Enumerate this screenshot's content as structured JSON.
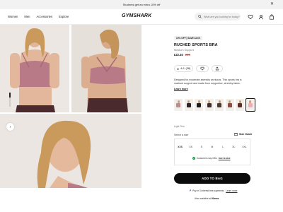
{
  "announcement": {
    "text": "Students get an extra 10% off"
  },
  "nav": {
    "items": [
      "Women",
      "Men",
      "Accessories",
      "Explore"
    ]
  },
  "brand": {
    "logo_text": "GYMSHARK"
  },
  "search": {
    "placeholder": "What are you looking for today?"
  },
  "header_icons": [
    "heart-icon",
    "user-icon",
    "bag-icon"
  ],
  "product": {
    "badge": "10% OFF | SAVE £2.60",
    "title": "RUCHED SPORTS BRA",
    "subtitle": "Medium Support",
    "sale_price": "£22.40",
    "original_price": "£26",
    "rating": "4.6",
    "review_count": "(38)",
    "description": "Designed for moderate-intensity workouts. This sports bra is marbust support and made from supportive, stretchy fabric.",
    "learn_more": "Learn more",
    "color_name": "Light Pink",
    "swatch_colors": [
      "#b98d8f",
      "#2b2424",
      "#1d1d1d",
      "#3a2f2c",
      "#4a3a33",
      "#8e4b40",
      "#5a2f2a",
      "#f0aab8"
    ],
    "size_label": "Select a size",
    "size_guide": "Size Guide",
    "sizes": [
      "XXS",
      "XS",
      "S",
      "M",
      "L",
      "XL",
      "XXL"
    ],
    "fit_note": "Customers say it fits",
    "fit_link": "true to size",
    "add_to_bag": "ADD TO BAG",
    "paypal_note": "Pay in 3 interest-free payments.",
    "paypal_link": "Learn more",
    "klarna_prefix": "Also available at",
    "klarna_brand": "Klarna."
  },
  "colors": {
    "accent": "#0b0b0b",
    "sale": "#c0392b",
    "fit_ok": "#1fa155"
  }
}
